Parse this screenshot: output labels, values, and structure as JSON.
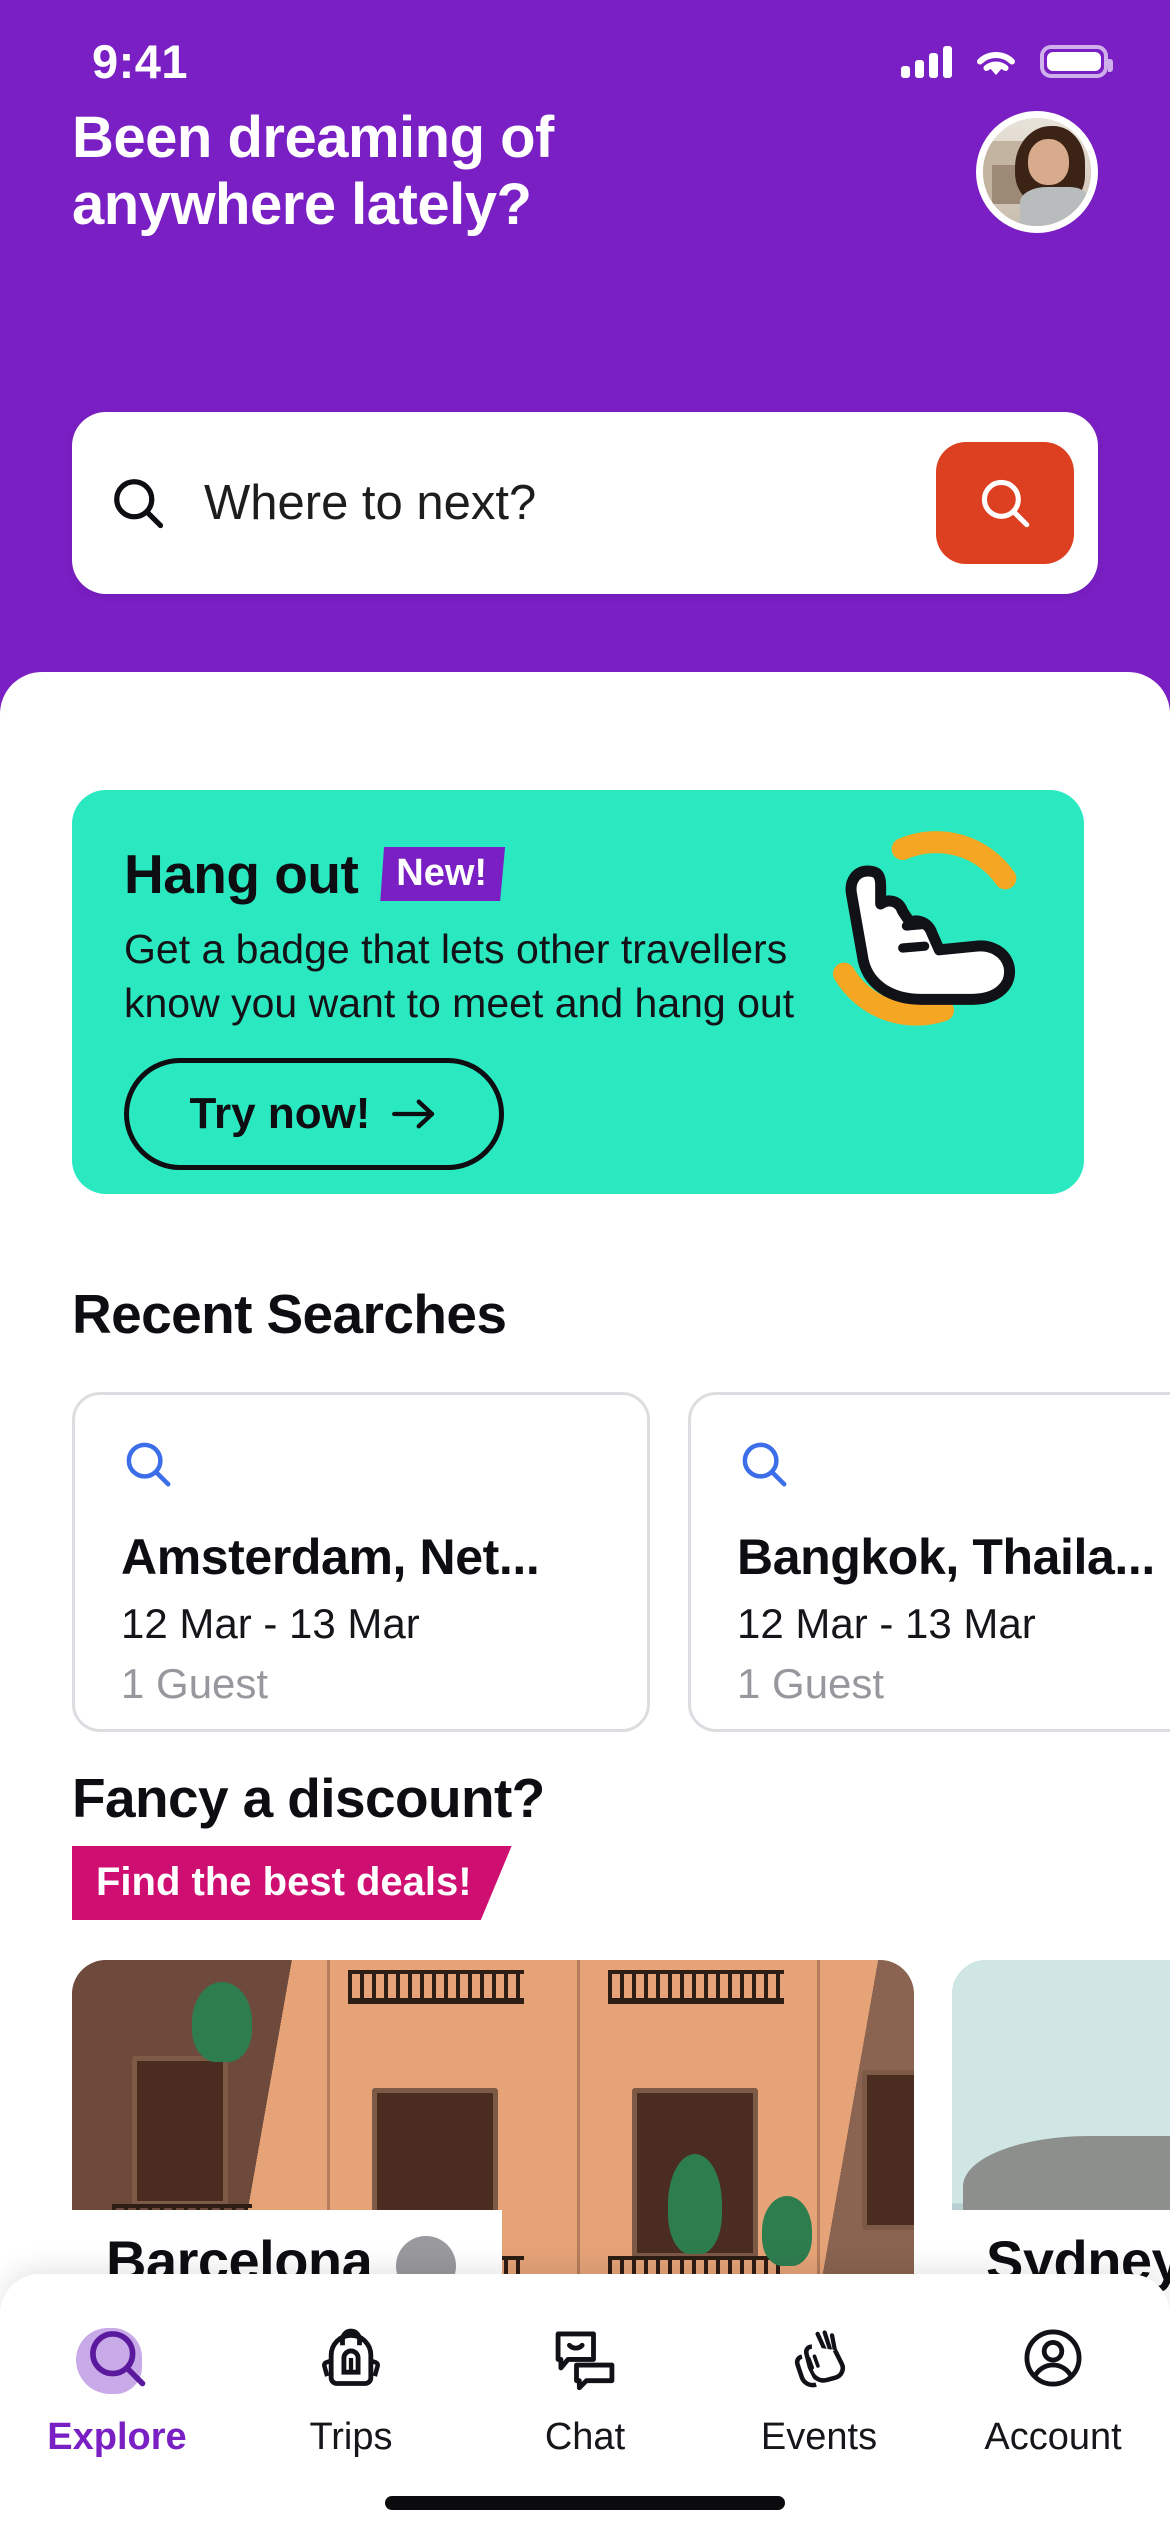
{
  "theme": {
    "brand_purple": "#7a1fc4",
    "accent_orange": "#dd4020",
    "teal": "#2ae8bf",
    "magenta": "#cf0e72",
    "blue_icon": "#3b6ee8"
  },
  "status_bar": {
    "time": "9:41",
    "signal_icon": "cellular-signal-icon",
    "wifi_icon": "wifi-icon",
    "battery_icon": "battery-icon"
  },
  "header": {
    "greeting_line1": "Been dreaming of",
    "greeting_line2": "anywhere lately?",
    "avatar_icon": "user-avatar"
  },
  "search": {
    "placeholder": "Where to next?",
    "value": "",
    "leading_icon": "search-icon",
    "submit_icon": "search-icon"
  },
  "hangout": {
    "title": "Hang out",
    "badge": "New!",
    "description_line1": "Get a badge that lets other travellers",
    "description_line2": "know you want to meet and hang out",
    "cta_label": "Try now!",
    "cta_icon": "arrow-right-icon",
    "art_icon": "shaka-hand-icon"
  },
  "recent_searches": {
    "title": "Recent Searches",
    "items": [
      {
        "icon": "search-icon",
        "destination": "Amsterdam, Net...",
        "dates": "12 Mar - 13 Mar",
        "guests": "1 Guest"
      },
      {
        "icon": "search-icon",
        "destination": "Bangkok, Thaila...",
        "dates": "12 Mar - 13 Mar",
        "guests": "1 Guest"
      }
    ]
  },
  "discounts": {
    "title": "Fancy a discount?",
    "badge": "Find the best deals!",
    "destinations": [
      {
        "name": "Barcelona",
        "image": "barcelona-building-facade-photo"
      },
      {
        "name": "Sydney",
        "image": "sydney-coast-photo"
      }
    ]
  },
  "tab_bar": {
    "items": [
      {
        "label": "Explore",
        "icon": "search-icon",
        "active": true
      },
      {
        "label": "Trips",
        "icon": "backpack-icon",
        "active": false
      },
      {
        "label": "Chat",
        "icon": "chat-bubbles-icon",
        "active": false
      },
      {
        "label": "Events",
        "icon": "clapping-hands-icon",
        "active": false
      },
      {
        "label": "Account",
        "icon": "user-circle-icon",
        "active": false
      }
    ]
  }
}
